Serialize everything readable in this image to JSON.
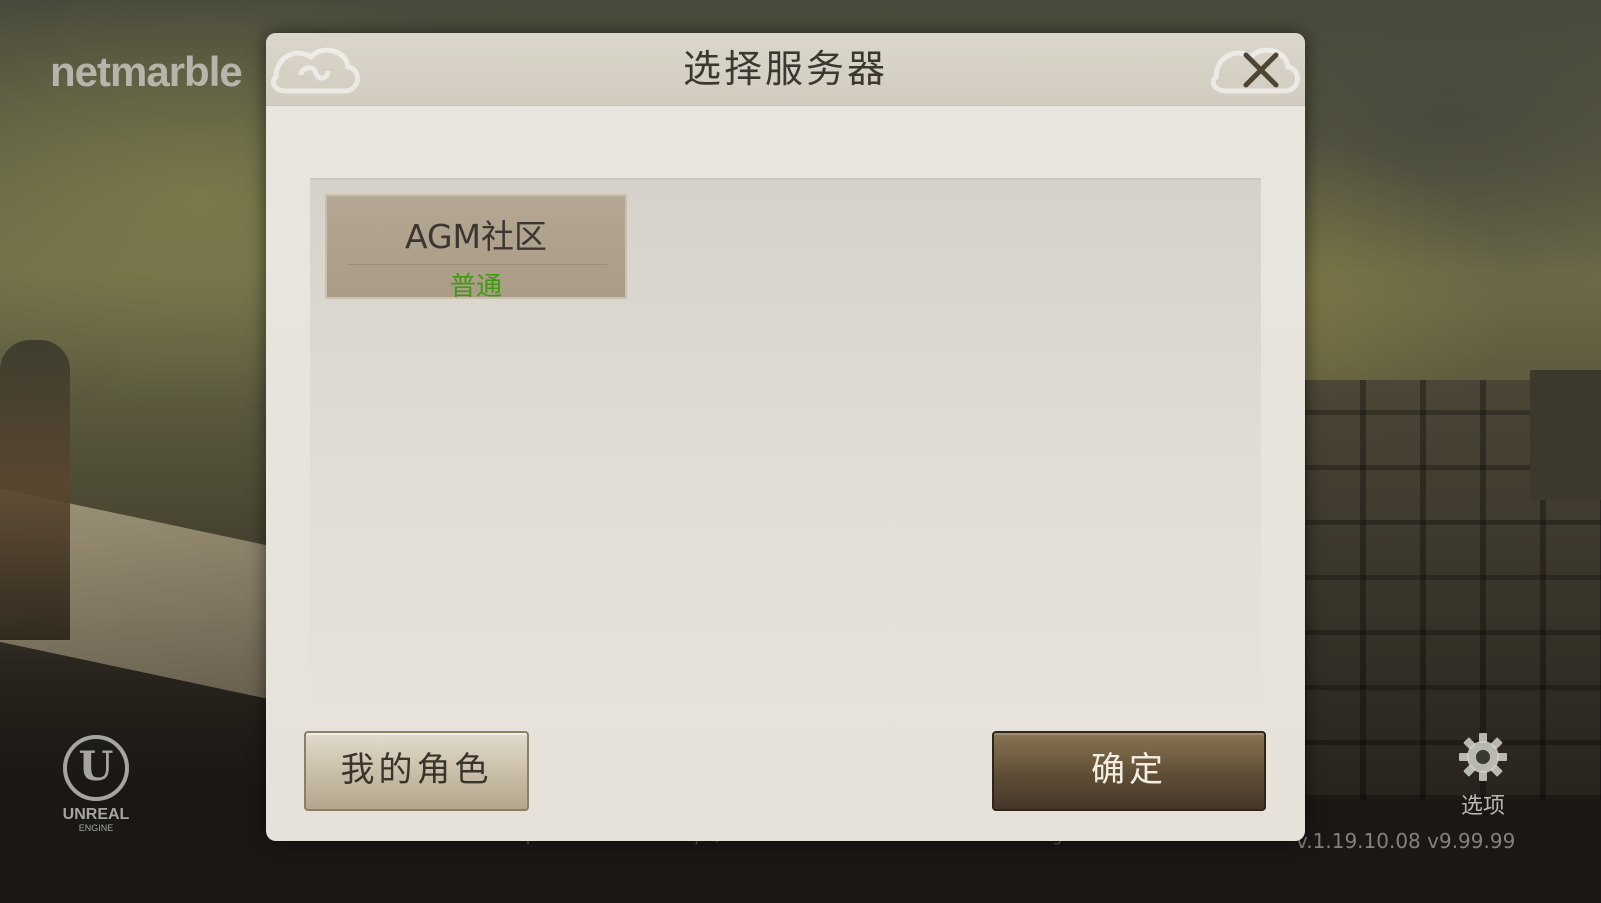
{
  "background": {
    "brand_logo": "netmarble",
    "engine_logo": {
      "line1": "UNREAL",
      "line2": "ENGINE"
    },
    "copyright": "© NCSOFT Corp. © Netmarble Corp. / Netmarble Benchmark Inc. 2018 All Rights Reserved.",
    "version": "v.1.19.10.08  v9.99.99",
    "options": {
      "label": "选项",
      "icon": "gear-icon"
    }
  },
  "dialog": {
    "title": "选择服务器",
    "close_icon": "close-icon",
    "servers": [
      {
        "name": "AGM社区",
        "status": "普通",
        "status_color": "#3f9a12"
      }
    ],
    "buttons": {
      "my_characters": "我的角色",
      "confirm": "确定"
    }
  },
  "colors": {
    "dialog_bg": "#e9e6df",
    "server_selected_bg": "#b4a793",
    "confirm_bg": "#5f4e36"
  }
}
